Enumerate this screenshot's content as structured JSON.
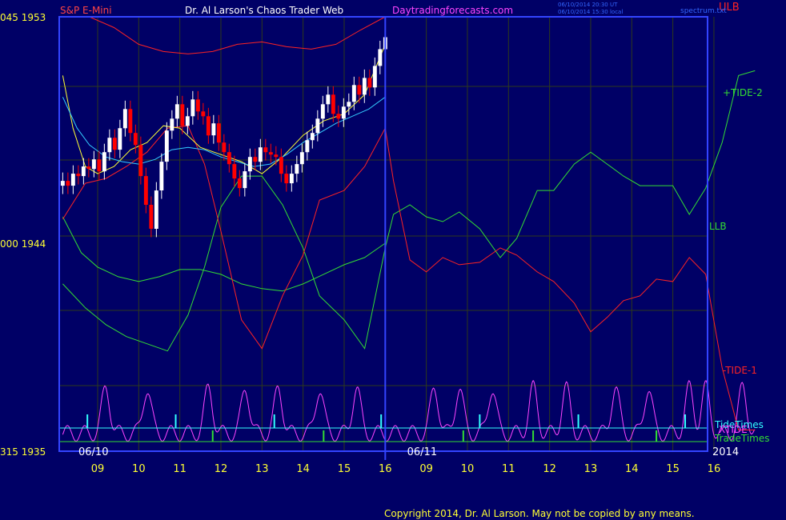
{
  "header": {
    "symbol": "S&P E-Mini",
    "title": "Dr. Al Larson's Chaos Trader Web",
    "site": "Daytradingforecasts.com",
    "timestamp_ut": "06/10/2014 20:30 UT",
    "timestamp_local": "06/10/2014 15:30 local",
    "spectrum_link": "spectrum.txt"
  },
  "footer": {
    "copyright": "Copyright 2014, Dr. Al Larson. May not be copied by any means."
  },
  "colors": {
    "background": "#000066",
    "grid": "#2e3a1a",
    "frame": "#3344ff",
    "price_up": "#ffffff",
    "price_down": "#ff0000",
    "ma_fast": "#ffff33",
    "ma_slow": "#33ccff",
    "ulb": "#ff2222",
    "llb": "#33dd33",
    "tide2": "#33dd33",
    "tide1": "#ff2222",
    "xtide": "#ff44ff",
    "tide_times": "#33ffff",
    "trade_times": "#33dd33",
    "axis_text": "#ffff33",
    "symbol_text": "#ff4444",
    "title_text": "#ffffff",
    "site_text": "#ff44ff"
  },
  "chart_data": {
    "type": "line",
    "title": "S&P E-Mini",
    "y_labels": [
      {
        "prefix": "045",
        "price": "1953",
        "value": 1953.45
      },
      {
        "prefix": "000",
        "price": "1944",
        "value": 1944.0
      },
      {
        "prefix": "315",
        "price": "1935",
        "value": 1935.315
      }
    ],
    "ylim": [
      1935.315,
      1953.45
    ],
    "hour_ticks": [
      "09",
      "10",
      "11",
      "12",
      "13",
      "14",
      "15",
      "16",
      "09",
      "10",
      "11",
      "12",
      "13",
      "14",
      "15",
      "16"
    ],
    "date_labels": [
      {
        "label": "06/10",
        "after_tick": 0
      },
      {
        "label": "06/11",
        "after_tick": 8
      }
    ],
    "year_label": "2014",
    "now_tick": 7,
    "candles": {
      "start_tick": -0.85,
      "end_tick": 7,
      "closes": [
        1946.6,
        1946.4,
        1946.9,
        1946.8,
        1947.2,
        1947.1,
        1947.5,
        1947.0,
        1947.8,
        1948.4,
        1947.9,
        1948.8,
        1949.6,
        1948.6,
        1948.1,
        1946.8,
        1945.6,
        1944.6,
        1946.2,
        1947.4,
        1948.7,
        1949.2,
        1949.8,
        1948.9,
        1949.3,
        1950.0,
        1949.5,
        1949.3,
        1948.5,
        1949.0,
        1948.2,
        1947.8,
        1947.3,
        1946.7,
        1946.3,
        1947.0,
        1947.6,
        1947.4,
        1948.0,
        1947.8,
        1947.7,
        1947.6,
        1946.9,
        1946.5,
        1946.9,
        1947.3,
        1947.8,
        1948.3,
        1948.6,
        1949.2,
        1949.8,
        1950.2,
        1949.4,
        1949.2,
        1949.7,
        1949.9,
        1950.6,
        1950.2,
        1950.9,
        1950.5,
        1951.4,
        1952.1,
        1952.6
      ]
    },
    "series": [
      {
        "name": "ULB",
        "color_key": "ulb",
        "x": [
          -0.85,
          -0.2,
          0.4,
          1.0,
          1.6,
          2.2,
          2.8,
          3.4,
          4.0,
          4.6,
          5.2,
          5.8,
          6.4,
          7.0
        ],
        "y": [
          1954.2,
          1953.7,
          1953.0,
          1952.3,
          1952.0,
          1951.9,
          1952.0,
          1952.3,
          1952.4,
          1952.2,
          1952.1,
          1952.3,
          1952.9,
          1953.7
        ]
      },
      {
        "name": "LLB",
        "color_key": "llb",
        "x": [
          -0.85,
          -0.4,
          0.0,
          0.5,
          1.0,
          1.5,
          2.0,
          2.5,
          3.0,
          3.5,
          4.0,
          4.5,
          5.0,
          5.5,
          6.0,
          6.5,
          7.0
        ],
        "y": [
          1945.1,
          1943.6,
          1943.0,
          1942.6,
          1942.4,
          1942.6,
          1942.9,
          1942.9,
          1942.7,
          1942.3,
          1942.1,
          1942.0,
          1942.3,
          1942.7,
          1943.1,
          1943.4,
          1944.0
        ]
      },
      {
        "name": "+TIDE-2",
        "color_key": "tide2",
        "x": [
          -0.85,
          -0.3,
          0.2,
          0.7,
          1.2,
          1.7,
          2.2,
          2.6,
          3.0,
          3.5,
          4.0,
          4.5,
          5.0,
          5.4,
          6.0,
          6.5,
          7.0,
          7.2,
          7.6,
          8.0,
          8.4,
          8.8,
          9.3,
          9.8,
          10.2,
          10.7,
          11.1,
          11.6,
          12.0,
          12.4,
          12.8,
          13.2,
          13.6,
          14.0,
          14.4,
          14.8,
          15.2,
          15.6,
          16.0
        ],
        "y": [
          1942.3,
          1941.3,
          1940.6,
          1940.1,
          1939.8,
          1939.5,
          1941.0,
          1943.0,
          1945.5,
          1946.8,
          1946.8,
          1945.6,
          1943.8,
          1941.8,
          1940.8,
          1939.6,
          1943.8,
          1945.2,
          1945.6,
          1945.1,
          1944.9,
          1945.3,
          1944.6,
          1943.4,
          1944.2,
          1946.2,
          1946.2,
          1947.3,
          1947.8,
          1947.3,
          1946.8,
          1946.4,
          1946.4,
          1946.4,
          1945.2,
          1946.3,
          1948.2,
          1951.0,
          1951.2
        ]
      },
      {
        "name": "-TIDE-1",
        "color_key": "tide1",
        "x": [
          -0.85,
          -0.3,
          0.2,
          0.7,
          1.2,
          1.7,
          2.2,
          2.6,
          3.0,
          3.5,
          4.0,
          4.5,
          5.0,
          5.4,
          6.0,
          6.5,
          7.0,
          7.2,
          7.6,
          8.0,
          8.4,
          8.8,
          9.3,
          9.8,
          10.2,
          10.7,
          11.1,
          11.6,
          12.0,
          12.4,
          12.8,
          13.2,
          13.6,
          14.0,
          14.4,
          14.8,
          15.2,
          15.6,
          16.0
        ],
        "y": [
          1945.0,
          1946.5,
          1946.7,
          1947.2,
          1947.8,
          1948.8,
          1948.9,
          1947.3,
          1944.5,
          1940.8,
          1939.6,
          1941.8,
          1943.5,
          1945.8,
          1946.2,
          1947.2,
          1948.8,
          1946.6,
          1943.3,
          1942.8,
          1943.4,
          1943.1,
          1943.2,
          1943.8,
          1943.5,
          1942.8,
          1942.4,
          1941.5,
          1940.3,
          1940.9,
          1941.6,
          1941.8,
          1942.5,
          1942.4,
          1943.4,
          1942.7,
          1938.8,
          1936.2,
          1936.2
        ]
      },
      {
        "name": "MA fast",
        "color_key": "ma_fast",
        "x": [
          -0.85,
          -0.6,
          -0.3,
          0.0,
          0.4,
          0.8,
          1.2,
          1.6,
          2.0,
          2.5,
          3.0,
          3.5,
          4.0,
          4.5,
          5.0,
          5.5,
          6.0,
          6.5,
          7.0
        ],
        "y": [
          1951.0,
          1948.8,
          1947.2,
          1946.9,
          1947.2,
          1947.9,
          1948.2,
          1948.9,
          1948.8,
          1948.0,
          1947.7,
          1947.4,
          1946.9,
          1947.6,
          1948.5,
          1949.1,
          1949.4,
          1950.2,
          1952.3
        ]
      },
      {
        "name": "MA slow",
        "color_key": "ma_slow",
        "x": [
          -0.85,
          -0.5,
          -0.2,
          0.2,
          0.6,
          1.0,
          1.4,
          1.8,
          2.2,
          2.6,
          3.0,
          3.4,
          3.8,
          4.2,
          4.6,
          5.0,
          5.4,
          5.8,
          6.2,
          6.6,
          7.0
        ],
        "y": [
          1950.1,
          1948.8,
          1948.1,
          1947.6,
          1947.4,
          1947.3,
          1947.5,
          1947.9,
          1948.0,
          1947.9,
          1947.6,
          1947.4,
          1947.2,
          1947.3,
          1947.7,
          1948.2,
          1948.6,
          1949.0,
          1949.3,
          1949.6,
          1950.1
        ]
      }
    ],
    "xtide": {
      "name": "XTIDE",
      "period": 0.42,
      "amplitude": 1.0,
      "peaks": [
        0.2,
        1.2,
        2.7,
        3.6,
        4.4,
        5.4,
        6.3,
        8.2,
        8.8,
        9.6,
        10.6,
        11.4,
        12.6,
        13.4,
        14.4,
        14.8,
        15.7
      ]
    },
    "tide_times": {
      "name": "TideTimes",
      "ticks": [
        -0.25,
        1.9,
        4.3,
        6.9,
        9.3,
        11.7,
        14.3
      ]
    },
    "trade_times": {
      "name": "TradeTimes",
      "ticks": [
        2.8,
        5.5,
        8.9,
        10.6,
        13.6
      ]
    },
    "legend_labels": [
      "ULB",
      "+TIDE-2",
      "LLB",
      "-TIDE-1",
      "TideTimes",
      "XTIDE",
      "TradeTimes"
    ]
  }
}
